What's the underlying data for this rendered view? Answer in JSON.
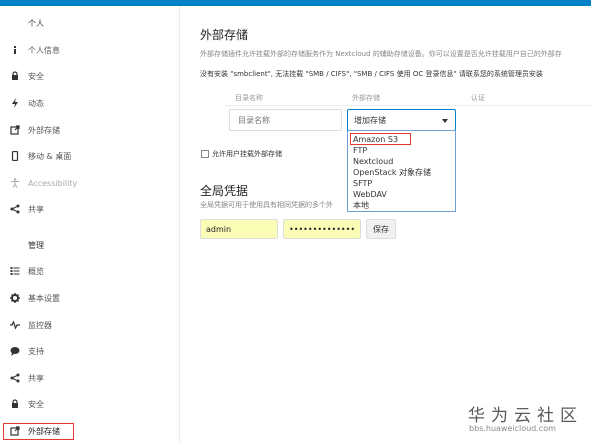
{
  "sidebar": {
    "personal_heading": "个人",
    "admin_heading": "管理",
    "personal_items": [
      {
        "label": "个人信息",
        "icon": "info-icon"
      },
      {
        "label": "安全",
        "icon": "lock-icon"
      },
      {
        "label": "动态",
        "icon": "flash-icon"
      },
      {
        "label": "外部存储",
        "icon": "external-link-icon"
      },
      {
        "label": "移动 & 桌面",
        "icon": "phone-icon"
      },
      {
        "label": "Accessibility",
        "icon": "accessibility-icon"
      },
      {
        "label": "共享",
        "icon": "share-icon"
      }
    ],
    "admin_items": [
      {
        "label": "概览",
        "icon": "list-icon"
      },
      {
        "label": "基本设置",
        "icon": "gear-icon"
      },
      {
        "label": "监控器",
        "icon": "activity-icon"
      },
      {
        "label": "支持",
        "icon": "chat-bubble-icon"
      },
      {
        "label": "共享",
        "icon": "share-icon"
      },
      {
        "label": "安全",
        "icon": "lock-icon"
      },
      {
        "label": "外部存储",
        "icon": "external-link-icon"
      }
    ]
  },
  "main": {
    "title": "外部存储",
    "description": "外部存储插件允许挂载外部的存储服务作为 Nextcloud 的辅助存储设备。你可以设置是否允许挂载用户自己的外部存",
    "warning": "没有安装 \"smbclient\", 无法挂载 \"SMB / CIFS\", \"SMB / CIFS 使用 OC 登录信息\" 请联系您的系统管理员安装",
    "columns": {
      "folder": "目录名称",
      "external": "外部存储",
      "auth": "认证"
    },
    "folder_placeholder": "目录名称",
    "select_label": "增加存储",
    "dropdown_options": [
      "Amazon S3",
      "FTP",
      "Nextcloud",
      "OpenStack 对象存储",
      "SFTP",
      "WebDAV",
      "本地"
    ],
    "allow_user_mount": "允许用户挂载外部存储",
    "global_title": "全局凭据",
    "global_description": "全局凭据可用于使用具有相同凭据的多个外",
    "username": "admin",
    "password": "••••••••••••••",
    "save_label": "保存"
  },
  "watermark": {
    "brand": "华为云社区",
    "url": "bbs.huaweicloud.com"
  },
  "colors": {
    "accent": "#0082c9",
    "highlight": "#e53935",
    "autofill": "#fafdb6"
  }
}
